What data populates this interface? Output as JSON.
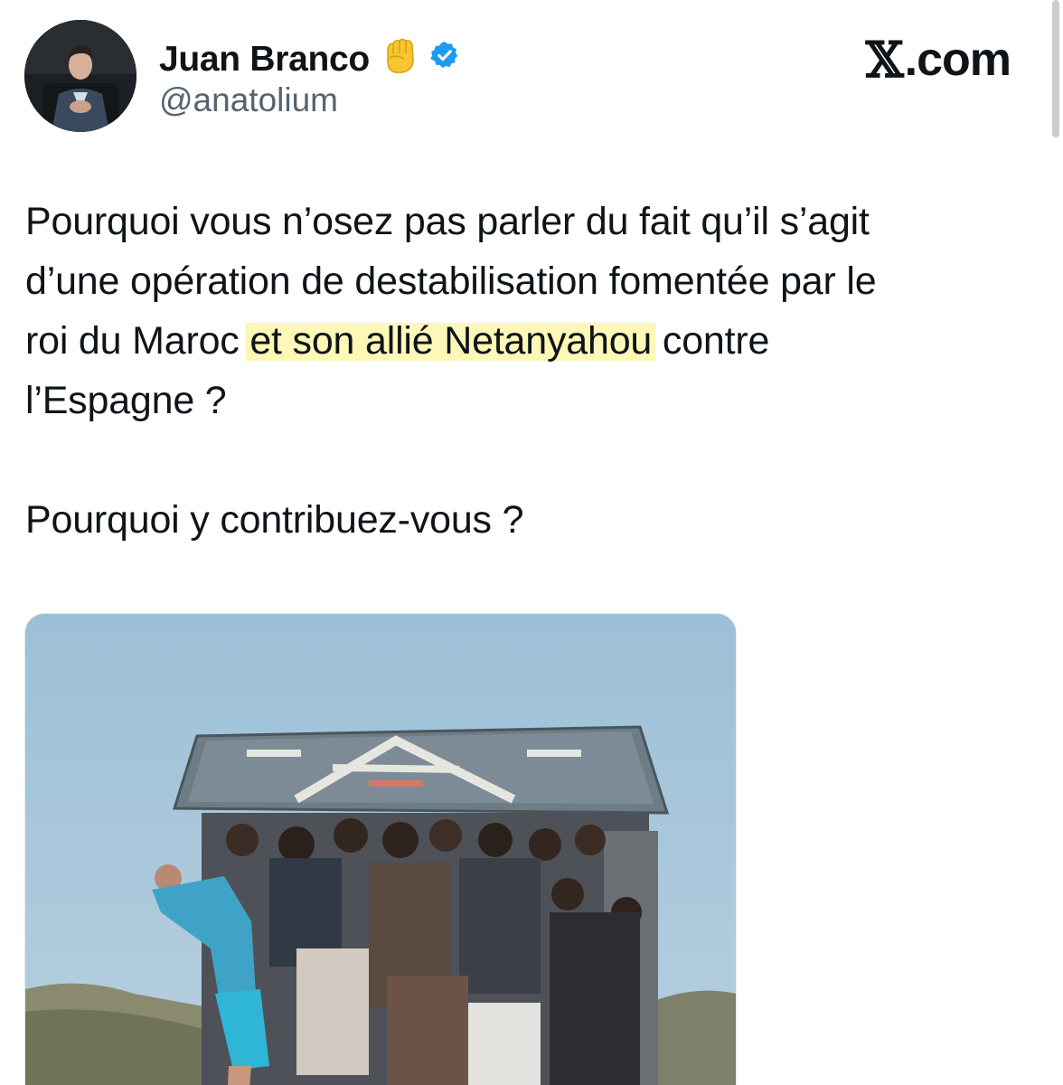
{
  "author": {
    "name": "Juan Branco",
    "emoji": "✊",
    "handle": "@anatolium",
    "verified": true
  },
  "site": {
    "logo_symbol": "𝕏",
    "logo_text": ".com"
  },
  "tweet": {
    "line1": "Pourquoi vous n’osez pas parler du fait qu’il s’agit",
    "line2": "d’une opération de destabilisation fomentée par le",
    "line3_before": "roi du Maroc ",
    "line3_highlight": "et son allié Netanyahou",
    "line3_after": " contre",
    "line4": "l’Espagne ?",
    "question": "Pourquoi y contribuez-vous ?"
  },
  "colors": {
    "text": "#0f1419",
    "secondary": "#536471",
    "verified_blue": "#1d9bf0",
    "highlight": "#fdf7b8"
  },
  "icons": {
    "verified": "verified-badge-icon",
    "fist": "raised-fist-emoji"
  }
}
